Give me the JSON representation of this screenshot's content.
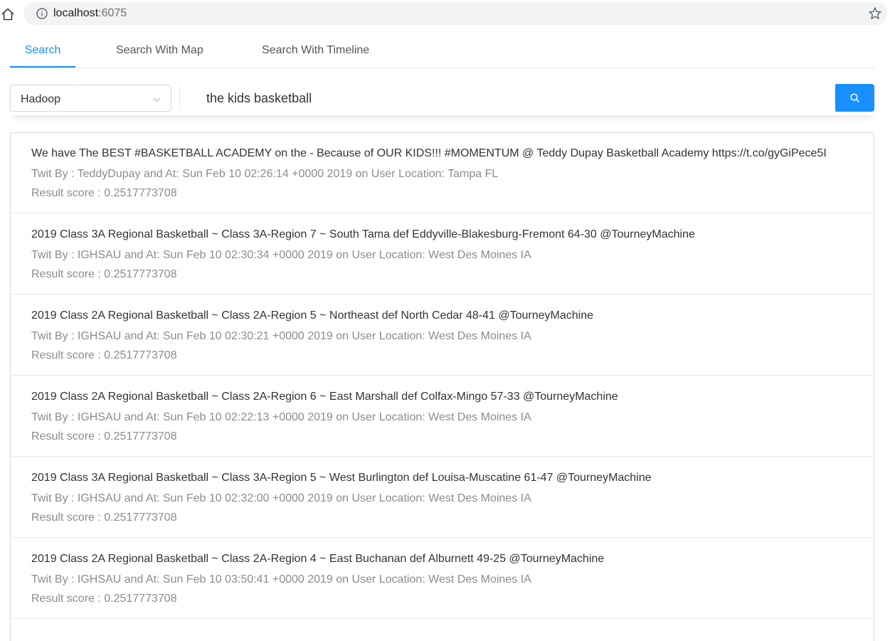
{
  "browser": {
    "url_host": "localhost",
    "url_port": ":6075"
  },
  "tabs": [
    {
      "label": "Search",
      "active": true
    },
    {
      "label": "Search With Map",
      "active": false
    },
    {
      "label": "Search With Timeline",
      "active": false
    }
  ],
  "search": {
    "engine_selected": "Hadoop",
    "query": "the kids basketball",
    "button_icon": "search-icon"
  },
  "results": [
    {
      "text": "We have The BEST #BASKETBALL ACADEMY on the - Because of OUR KIDS!!! #MOMENTUM @ Teddy Dupay Basketball Academy https://t.co/gyGiPece5I",
      "meta": "Twit By : TeddyDupay and At: Sun Feb 10 02:26:14 +0000 2019 on User Location: Tampa FL",
      "score": "Result score : 0.2517773708"
    },
    {
      "text": "2019 Class 3A Regional Basketball ~ Class 3A-Region 7 ~ South Tama def Eddyville-Blakesburg-Fremont 64-30 @TourneyMachine",
      "meta": "Twit By : IGHSAU and At: Sun Feb 10 02:30:34 +0000 2019 on User Location: West Des Moines IA",
      "score": "Result score : 0.2517773708"
    },
    {
      "text": "2019 Class 2A Regional Basketball ~ Class 2A-Region 5 ~ Northeast def North Cedar 48-41 @TourneyMachine",
      "meta": "Twit By : IGHSAU and At: Sun Feb 10 02:30:21 +0000 2019 on User Location: West Des Moines IA",
      "score": "Result score : 0.2517773708"
    },
    {
      "text": "2019 Class 2A Regional Basketball ~ Class 2A-Region 6 ~ East Marshall def Colfax-Mingo 57-33 @TourneyMachine",
      "meta": "Twit By : IGHSAU and At: Sun Feb 10 02:22:13 +0000 2019 on User Location: West Des Moines IA",
      "score": "Result score : 0.2517773708"
    },
    {
      "text": "2019 Class 3A Regional Basketball ~ Class 3A-Region 5 ~ West Burlington def Louisa-Muscatine 61-47 @TourneyMachine",
      "meta": "Twit By : IGHSAU and At: Sun Feb 10 02:32:00 +0000 2019 on User Location: West Des Moines IA",
      "score": "Result score : 0.2517773708"
    },
    {
      "text": "2019 Class 2A Regional Basketball ~ Class 2A-Region 4 ~ East Buchanan def Alburnett 49-25 @TourneyMachine",
      "meta": "Twit By : IGHSAU and At: Sun Feb 10 03:50:41 +0000 2019 on User Location: West Des Moines IA",
      "score": "Result score : 0.2517773708"
    }
  ],
  "colors": {
    "accent": "#1890ff",
    "text": "#333333",
    "muted": "#8c8c8c"
  }
}
